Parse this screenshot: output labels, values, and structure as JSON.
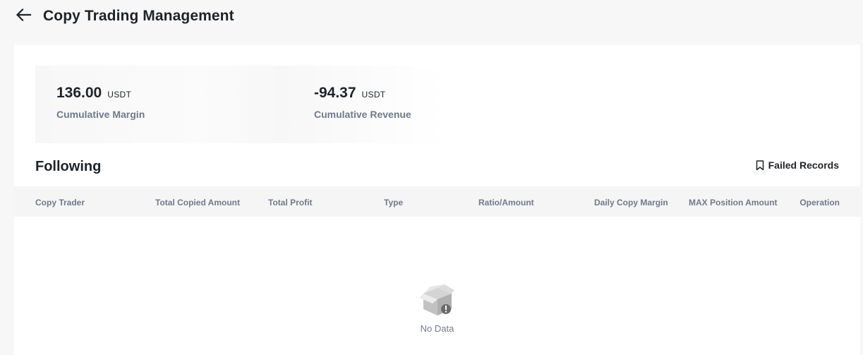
{
  "header": {
    "back_icon": "arrow-left-icon",
    "title": "Copy Trading Management"
  },
  "summary": {
    "cumulative_margin": {
      "value": "136.00",
      "unit": "USDT",
      "label": "Cumulative Margin"
    },
    "cumulative_revenue": {
      "value": "-94.37",
      "unit": "USDT",
      "label": "Cumulative Revenue"
    }
  },
  "following": {
    "title": "Following",
    "failed_records": {
      "icon": "bookmark-icon",
      "label": "Failed Records"
    },
    "columns": [
      "Copy Trader",
      "Total Copied Amount",
      "Total Profit",
      "Type",
      "Ratio/Amount",
      "Daily Copy Margin",
      "MAX Position Amount",
      "Operation"
    ],
    "empty": {
      "icon": "empty-box-icon",
      "text": "No Data"
    }
  }
}
